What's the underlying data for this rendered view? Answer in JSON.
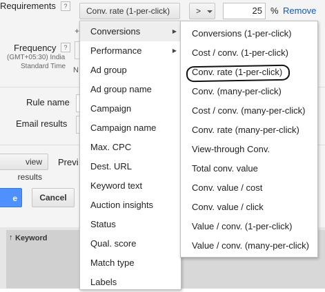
{
  "form": {
    "requirements_label": "Requirements",
    "metric_dropdown_value": "Conv. rate (1-per-click)",
    "operator_value": ">",
    "threshold_value": "25",
    "percent_unit": "%",
    "remove_link": "Remove",
    "frequency_label": "Frequency",
    "timezone_line1": "(GMT+05:30) India",
    "timezone_line2": "Standard Time",
    "partial_n": "N",
    "partial_plus": "+",
    "rule_name_label": "Rule name",
    "email_results_label": "Email results",
    "view_results_button": "view results",
    "preview_partial": "Previ",
    "save_partial": "e",
    "cancel_button": "Cancel",
    "keyword_header": "Keyword",
    "help_glyph": "?"
  },
  "left_menu": {
    "items": [
      {
        "label": "Conversions",
        "has_submenu": true,
        "selected": true
      },
      {
        "label": "Performance",
        "has_submenu": true,
        "selected": false
      },
      {
        "label": "Ad group",
        "has_submenu": false,
        "selected": false
      },
      {
        "label": "Ad group name",
        "has_submenu": false,
        "selected": false
      },
      {
        "label": "Campaign",
        "has_submenu": false,
        "selected": false
      },
      {
        "label": "Campaign name",
        "has_submenu": false,
        "selected": false
      },
      {
        "label": "Max. CPC",
        "has_submenu": false,
        "selected": false
      },
      {
        "label": "Dest. URL",
        "has_submenu": false,
        "selected": false
      },
      {
        "label": "Keyword text",
        "has_submenu": false,
        "selected": false
      },
      {
        "label": "Auction insights",
        "has_submenu": false,
        "selected": false
      },
      {
        "label": "Status",
        "has_submenu": false,
        "selected": false
      },
      {
        "label": "Qual. score",
        "has_submenu": false,
        "selected": false
      },
      {
        "label": "Match type",
        "has_submenu": false,
        "selected": false
      },
      {
        "label": "Labels",
        "has_submenu": false,
        "selected": false
      }
    ]
  },
  "submenu": {
    "items": [
      {
        "label": "Conversions (1-per-click)",
        "circled": false
      },
      {
        "label": "Cost / conv. (1-per-click)",
        "circled": false
      },
      {
        "label": "Conv. rate (1-per-click)",
        "circled": true
      },
      {
        "label": "Conv. (many-per-click)",
        "circled": false
      },
      {
        "label": "Cost / conv. (many-per-click)",
        "circled": false
      },
      {
        "label": "Conv. rate (many-per-click)",
        "circled": false
      },
      {
        "label": "View-through Conv.",
        "circled": false
      },
      {
        "label": "Total conv. value",
        "circled": false
      },
      {
        "label": "Conv. value / cost",
        "circled": false
      },
      {
        "label": "Conv. value / click",
        "circled": false
      },
      {
        "label": "Value / conv. (1-per-click)",
        "circled": false
      },
      {
        "label": "Value / conv. (many-per-click)",
        "circled": false
      }
    ]
  },
  "colors": {
    "form_background": "#f1f1f1",
    "save_blue": "#4d90fe",
    "link_blue": "#1155cc",
    "table_header_gray": "#d0d0d0"
  }
}
